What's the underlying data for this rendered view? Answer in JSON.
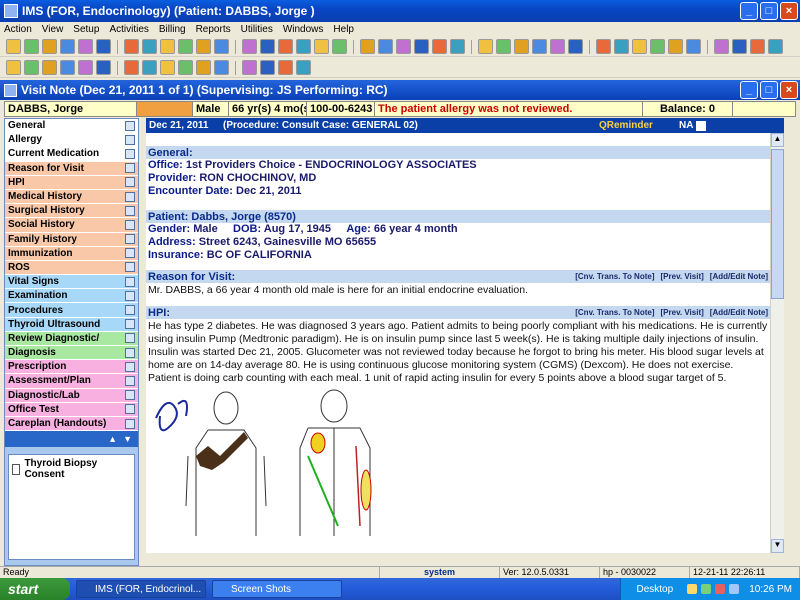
{
  "app_window": {
    "title": "IMS (FOR, Endocrinology)     (Patient: DABBS, Jorge )"
  },
  "menu": [
    "Action",
    "View",
    "Setup",
    "Activities",
    "Billing",
    "Reports",
    "Utilities",
    "Windows",
    "Help"
  ],
  "visit_window": {
    "title": "Visit Note (Dec 21, 2011     1 of 1) (Supervising: JS Performing: RC)"
  },
  "patient_bar": {
    "name": "DABBS, Jorge",
    "sex": "Male",
    "age": "66 yr(s) 4 mo(s)",
    "account": "100-00-6243",
    "alert": "The patient allergy was not reviewed.",
    "balance": "Balance: 0"
  },
  "sidebar": {
    "items": [
      {
        "label": "General",
        "color": "#ffffff"
      },
      {
        "label": "Allergy",
        "color": "#ffffff"
      },
      {
        "label": "Current Medication",
        "color": "#ffffff"
      },
      {
        "label": "Reason for Visit",
        "color": "#f9c8a8"
      },
      {
        "label": "HPI",
        "color": "#f9c8a8"
      },
      {
        "label": "Medical History",
        "color": "#f9c8a8"
      },
      {
        "label": "Surgical History",
        "color": "#f9c8a8"
      },
      {
        "label": "Social History",
        "color": "#f9c8a8"
      },
      {
        "label": "Family History",
        "color": "#f9c8a8"
      },
      {
        "label": "Immunization",
        "color": "#f9c8a8"
      },
      {
        "label": "ROS",
        "color": "#f9c8a8"
      },
      {
        "label": "Vital Signs",
        "color": "#a8d8f8"
      },
      {
        "label": "Examination",
        "color": "#a8d8f8"
      },
      {
        "label": "Procedures",
        "color": "#a8d8f8"
      },
      {
        "label": "Thyroid Ultrasound",
        "color": "#a8d8f8"
      },
      {
        "label": "Review Diagnostic/",
        "color": "#a8e8a0"
      },
      {
        "label": "Diagnosis",
        "color": "#a8e8a0"
      },
      {
        "label": "Prescription",
        "color": "#f8b0e0"
      },
      {
        "label": "Assessment/Plan",
        "color": "#f8b0e0"
      },
      {
        "label": "Diagnostic/Lab",
        "color": "#f8b0e0"
      },
      {
        "label": "Office Test",
        "color": "#f8b0e0"
      },
      {
        "label": "Careplan (Handouts)",
        "color": "#f8b0e0"
      }
    ],
    "documents": [
      "Thyroid Biopsy Consent"
    ]
  },
  "note": {
    "header_date": "Dec 21, 2011",
    "header_proc": "(Procedure:  Consult  Case: GENERAL 02)",
    "qreminder": "QReminder",
    "na": "NA",
    "general": {
      "heading": "General:",
      "office_label": "Office:",
      "office": "1st Providers Choice - ENDOCRINOLOGY ASSOCIATES",
      "provider_label": "Provider:",
      "provider": "RON CHOCHINOV, MD",
      "encounter_label": "Encounter Date:",
      "encounter": "Dec 21, 2011"
    },
    "patient": {
      "heading": "Patient: Dabbs, Jorge     (8570)",
      "gender_label": "Gender:",
      "gender": "Male",
      "dob_label": "DOB:",
      "dob": "Aug 17, 1945",
      "age_label": "Age:",
      "age": "66 year 4 month",
      "address_label": "Address:",
      "address": "Street 6243,  Gainesville  MO  65655",
      "insurance_label": "Insurance:",
      "insurance": "BC OF CALIFORNIA"
    },
    "links": {
      "cnv": "[Cnv. Trans. To Note]",
      "prev": "[Prev. Visit]",
      "add": "[Add/Edit Note]"
    },
    "reason": {
      "heading": "Reason for Visit:",
      "text": "Mr. DABBS, a 66 year 4 month old male is here for an initial endocrine evaluation."
    },
    "hpi": {
      "heading": "HPI:",
      "text": "He has type 2 diabetes. He was diagnosed 3 years ago. Patient admits to being poorly compliant with his medications. He is currently using insulin Pump (Medtronic paradigm). He is on insulin pump since last 5 week(s). He is taking multiple daily injections of insulin. Insulin was started Dec 21, 2005. Glucometer was not reviewed today because he forgot to bring his meter. His blood sugar levels at home are on 14-day average 80. He is using continuous glucose monitoring system (CGMS) (Dexcom). He does not exercise. Patient is doing carb counting with each meal. 1 unit of rapid acting insulin for every 5 points above a blood sugar target of 5."
    }
  },
  "status": {
    "ready": "Ready",
    "user": "system",
    "version": "Ver: 12.0.5.0331",
    "host": "hp - 0030022",
    "datetime": "12-21-11 22:26:11"
  },
  "taskbar": {
    "start": "start",
    "tasks": [
      "IMS (FOR, Endocrinol...",
      "Screen Shots"
    ],
    "desktop": "Desktop",
    "clock": "10:26 PM"
  }
}
